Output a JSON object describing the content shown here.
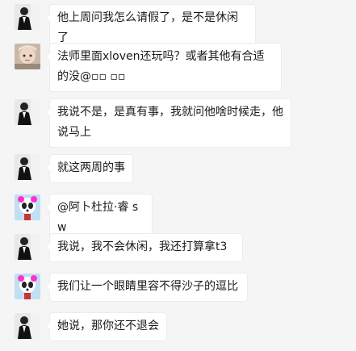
{
  "colors": {
    "background": "#f5f5f5",
    "bubble": "#ffffff",
    "bubble_border": "#ececec",
    "text": "#1a1a1a"
  },
  "messages": [
    {
      "avatar": "man-in-suit-avatar",
      "text": "他上周问我怎么请假了，是不是休闲了"
    },
    {
      "avatar": "baby-avatar",
      "text": "法师里面xloven还玩吗？或者其他有合适的没@▫▫ ▫▫"
    },
    {
      "avatar": "man-in-suit-avatar",
      "text": "我说不是，是真有事，我就问他啥时候走，他说马上"
    },
    {
      "avatar": "man-in-suit-avatar",
      "text": "就这两周的事"
    },
    {
      "avatar": "panda-avatar",
      "text": "@阿卜杜拉·睿 sw"
    },
    {
      "avatar": "man-in-suit-avatar",
      "text": "我说，我不会休闲，我还打算拿t3"
    },
    {
      "avatar": "panda-avatar",
      "text": "我们让一个眼睛里容不得沙子的逗比"
    },
    {
      "avatar": "man-in-suit-avatar",
      "text": "她说，那你还不退会"
    }
  ]
}
